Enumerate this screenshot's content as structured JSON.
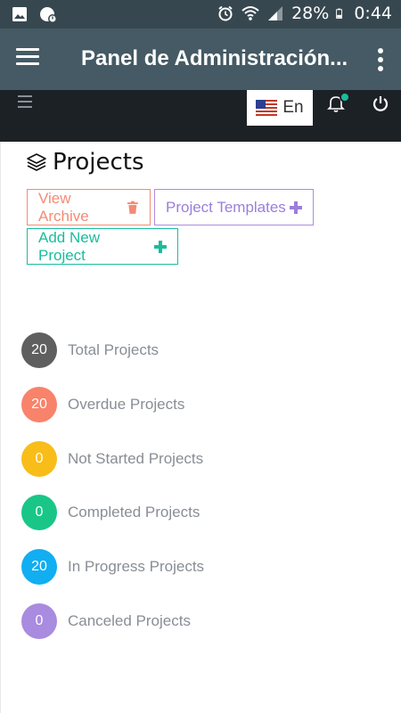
{
  "status_bar": {
    "battery": "28%",
    "time": "0:44"
  },
  "app_bar": {
    "title": "Panel de Administración..."
  },
  "header": {
    "language": "En"
  },
  "page": {
    "title": "Projects"
  },
  "buttons": {
    "view_archive": "View Archive",
    "project_templates": "Project Templates",
    "add_new_project": "Add New Project"
  },
  "stats": [
    {
      "count": "20",
      "label": "Total Projects",
      "color": "#5f5f5f"
    },
    {
      "count": "20",
      "label": "Overdue Projects",
      "color": "#f9826a"
    },
    {
      "count": "0",
      "label": "Not Started Projects",
      "color": "#f8bd19"
    },
    {
      "count": "0",
      "label": "Completed Projects",
      "color": "#19c688"
    },
    {
      "count": "20",
      "label": "In Progress Projects",
      "color": "#11aef2"
    },
    {
      "count": "0",
      "label": "Canceled Projects",
      "color": "#a98be0"
    }
  ],
  "icons": [
    "image-icon",
    "alert-icon",
    "alarm-icon",
    "wifi-icon",
    "signal-icon",
    "battery-icon",
    "menu-icon",
    "more-icon",
    "us-flag-icon",
    "bell-icon",
    "power-icon",
    "layers-icon",
    "trash-icon",
    "plus-icon"
  ]
}
